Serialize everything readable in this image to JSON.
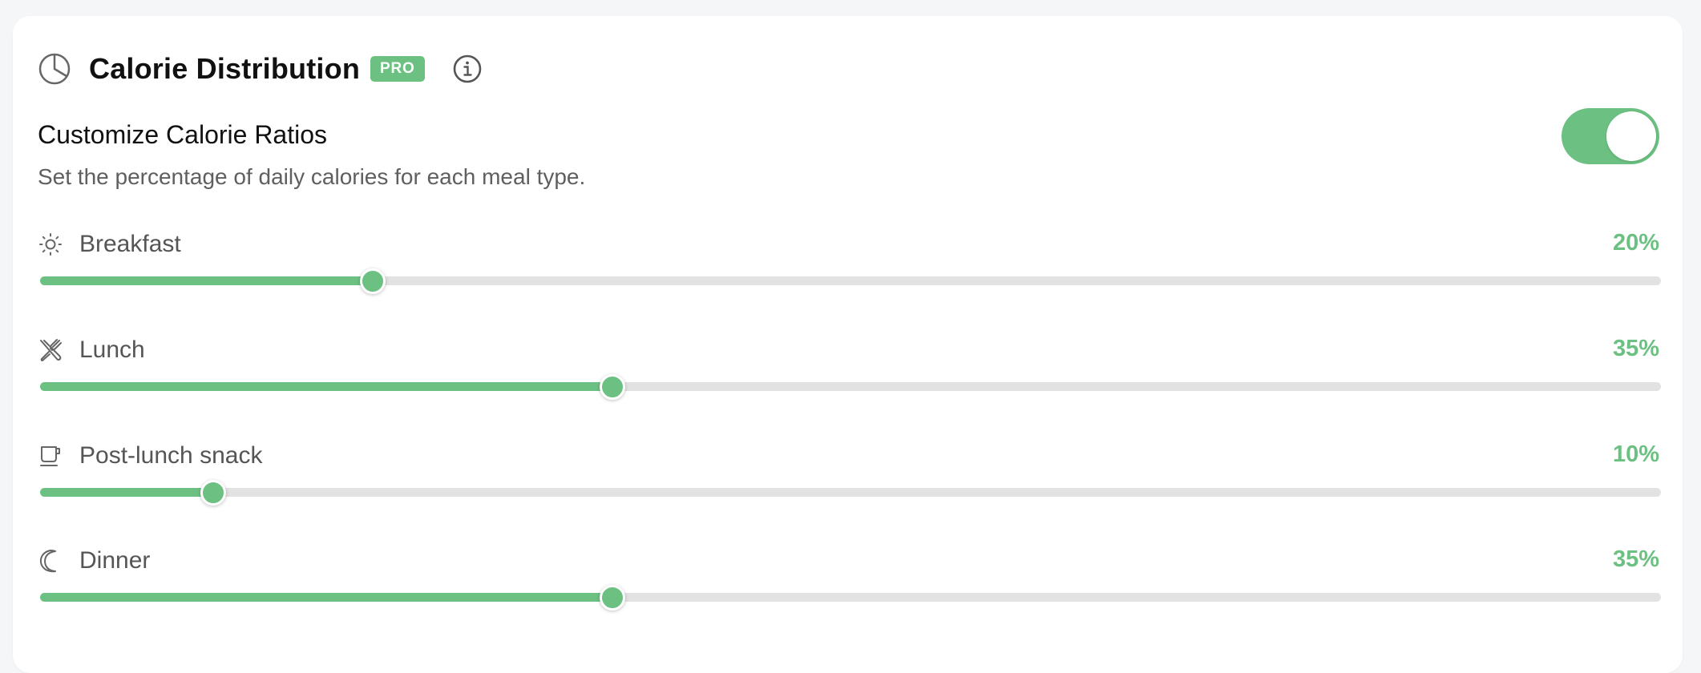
{
  "header": {
    "title": "Calorie Distribution",
    "badge": "PRO",
    "icon": "pie-chart-icon",
    "info_icon": "info-icon"
  },
  "customize": {
    "title": "Customize Calorie Ratios",
    "description": "Set the percentage of daily calories for each meal type.",
    "toggle_on": true
  },
  "colors": {
    "accent": "#6cc182",
    "track": "#e2e2e2",
    "text_primary": "#111111",
    "text_secondary": "#5f5f5f"
  },
  "meals": [
    {
      "label": "Breakfast",
      "percent_label": "20%",
      "slider_fraction": 0.205,
      "icon": "sun-icon"
    },
    {
      "label": "Lunch",
      "percent_label": "35%",
      "slider_fraction": 0.353,
      "icon": "utensils-icon"
    },
    {
      "label": "Post-lunch snack",
      "percent_label": "10%",
      "slider_fraction": 0.107,
      "icon": "coffee-cup-icon"
    },
    {
      "label": "Dinner",
      "percent_label": "35%",
      "slider_fraction": 0.353,
      "icon": "moon-icon"
    }
  ]
}
